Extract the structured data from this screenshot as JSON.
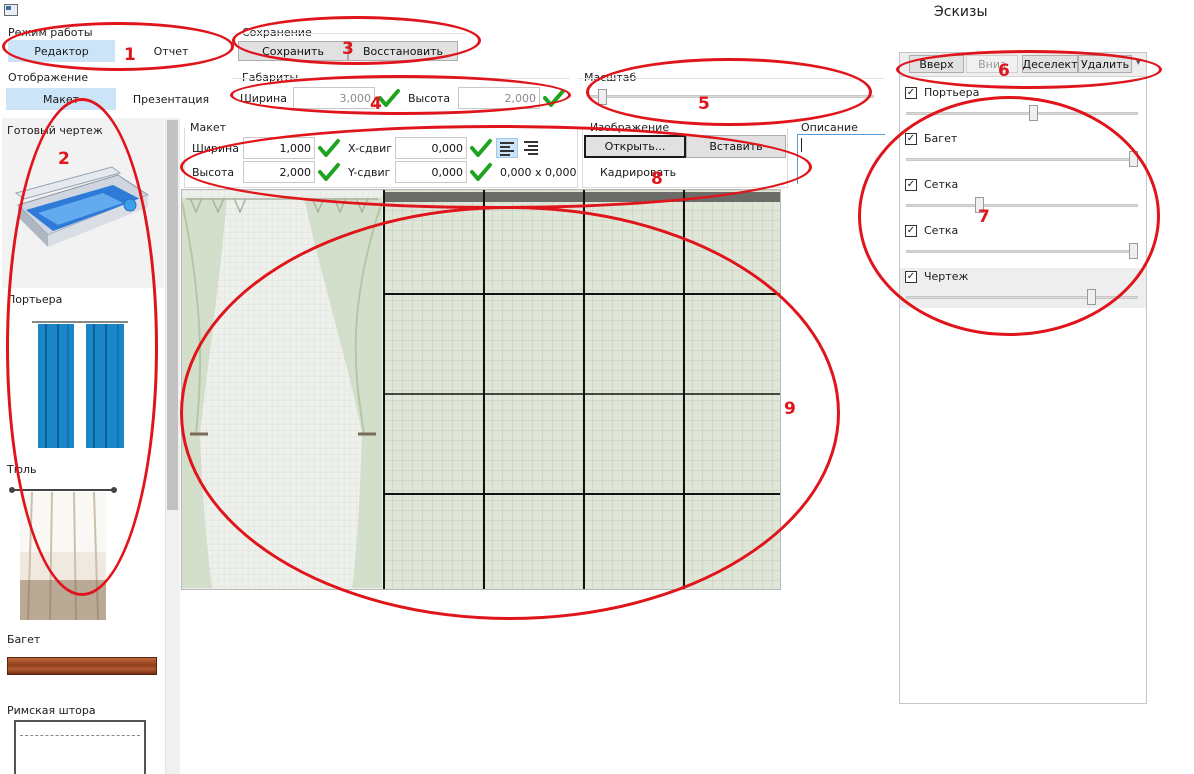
{
  "window": {
    "title": "Эскизы"
  },
  "mode": {
    "group_label": "Режим работы",
    "options": [
      "Редактор",
      "Отчет"
    ],
    "selected": "Редактор"
  },
  "saving": {
    "group_label": "Сохранение",
    "save_label": "Сохранить",
    "restore_label": "Восстановить"
  },
  "display": {
    "group_label": "Отображение",
    "options": [
      "Макет",
      "Презентация"
    ],
    "selected": "Макет"
  },
  "dimensions": {
    "group_label": "Габариты",
    "width_label": "Ширина",
    "width_value": "3,000",
    "height_label": "Высота",
    "height_value": "2,000"
  },
  "scale": {
    "group_label": "Масштаб",
    "level": 0.03
  },
  "layers_toolbar": {
    "up_label": "Вверх",
    "down_label": "Вниз",
    "deselect_label": "Деселект",
    "delete_label": "Удалить"
  },
  "layers": [
    {
      "name": "Портьера",
      "checked": true,
      "level": 0.55
    },
    {
      "name": "Багет",
      "checked": true,
      "level": 1.0
    },
    {
      "name": "Сетка",
      "checked": true,
      "level": 0.31
    },
    {
      "name": "Сетка",
      "checked": true,
      "level": 1.0
    },
    {
      "name": "Чертеж",
      "checked": true,
      "level": 0.81
    }
  ],
  "gallery": {
    "items": [
      "Готовый чертеж",
      "Портьера",
      "Тюль",
      "Багет",
      "Римская штора"
    ]
  },
  "layout": {
    "group_label": "Макет",
    "width_label": "Ширина",
    "width_value": "1,000",
    "height_label": "Высота",
    "height_value": "2,000",
    "x_shift_label": "X-сдвиг",
    "x_shift_value": "0,000",
    "y_shift_label": "Y-сдвиг",
    "y_shift_value": "0,000",
    "size_readout": "0,000 x 0,000"
  },
  "image": {
    "group_label": "Изображение",
    "open_label": "Открыть...",
    "paste_label": "Вставить",
    "crop_label": "Кадрировать"
  },
  "description": {
    "group_label": "Описание"
  },
  "annotations": [
    "1",
    "2",
    "3",
    "4",
    "5",
    "6",
    "7",
    "8",
    "9"
  ],
  "colors": {
    "annotation": "#e0141b",
    "selected_segment": "#cce4f7",
    "check_green": "#1fa31f",
    "curtain_blue": "#1a86c8"
  }
}
